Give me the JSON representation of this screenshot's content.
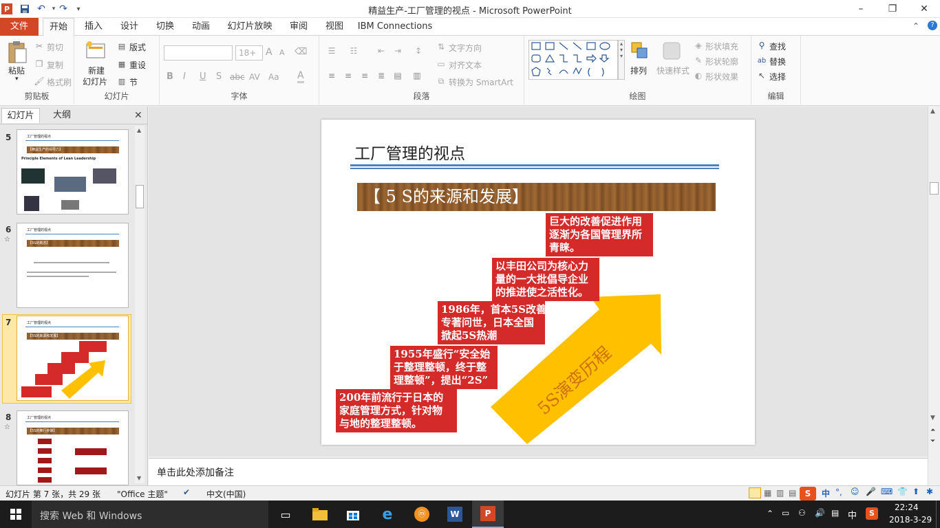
{
  "window": {
    "title": "精益生产-工厂管理的视点 - Microsoft PowerPoint",
    "minimize": "–",
    "maximize": "❐",
    "close": "✕"
  },
  "tabs": {
    "file": "文件",
    "home": "开始",
    "insert": "插入",
    "design": "设计",
    "transitions": "切换",
    "animations": "动画",
    "slideshow": "幻灯片放映",
    "review": "审阅",
    "view": "视图",
    "ibm": "IBM Connections"
  },
  "ribbon": {
    "clipboard": {
      "label": "剪贴板",
      "paste": "粘贴",
      "cut": "剪切",
      "copy": "复制",
      "format_painter": "格式刷"
    },
    "slides": {
      "label": "幻灯片",
      "new_slide_1": "新建",
      "new_slide_2": "幻灯片",
      "layout": "版式",
      "reset": "重设",
      "section": "节"
    },
    "font": {
      "label": "字体",
      "size_placeholder": "18+",
      "bold": "B",
      "italic": "I",
      "underline": "U",
      "shadow": "S",
      "strike": "abc",
      "spacing": "AV",
      "case": "Aa",
      "color": "A",
      "grow": "A",
      "shrink": "A"
    },
    "paragraph": {
      "label": "段落",
      "text_direction": "文字方向",
      "align_text": "对齐文本",
      "smartart": "转换为 SmartArt"
    },
    "drawing": {
      "label": "绘图",
      "arrange": "排列",
      "quick_styles": "快速样式",
      "shape_fill": "形状填充",
      "shape_outline": "形状轮廓",
      "shape_effects": "形状效果"
    },
    "editing": {
      "label": "编辑",
      "find": "查找",
      "replace": "替换",
      "select": "选择"
    }
  },
  "panel": {
    "tab_slides": "幻灯片",
    "tab_outline": "大纲",
    "close": "✕",
    "thumbs": [
      {
        "num": "5",
        "title": "工厂管理的视点",
        "band": "【精益生产的领导力】",
        "heading": "Principle Elements of Lean Leadership"
      },
      {
        "num": "6",
        "title": "工厂管理的视点",
        "band": "【5S的概念】",
        "star": "☆"
      },
      {
        "num": "7",
        "title": "工厂管理的视点",
        "band": "【5S的来源和发展】"
      },
      {
        "num": "8",
        "title": "工厂管理的视点",
        "band": "【5S的推行步骤】",
        "star": "☆"
      }
    ]
  },
  "slide": {
    "title": "工厂管理的视点",
    "band": "【 5 S的来源和发展】",
    "boxes": [
      "巨大的改善促进作用\n逐渐为各国管理界所\n青睐。",
      "以丰田公司为核心力\n量的一大批倡导企业\n的推进使之活性化。",
      "1986年，首本5S改善\n专著问世，日本全国\n掀起5S热潮",
      "1955年盛行“安全始\n于整理整顿，终于整\n理整顿”，提出“2S”",
      "200年前流行于日本的\n家庭管理方式，针对物\n与地的整理整顿。"
    ],
    "arrow_text": "5S演变历程"
  },
  "notes": {
    "placeholder": "单击此处添加备注"
  },
  "status": {
    "slide_info": "幻灯片 第 7 张，共 29 张",
    "theme": "\"Office 主题\"",
    "language": "中文(中国)"
  },
  "taskbar": {
    "search": "搜索 Web 和 Windows",
    "time": "22:24",
    "date": "2018-3-29",
    "ime": "中"
  },
  "colors": {
    "accent": "#d24726",
    "red_box": "#d42a2a",
    "arrow": "#ffc000",
    "line_blue": "#4f81bd"
  }
}
